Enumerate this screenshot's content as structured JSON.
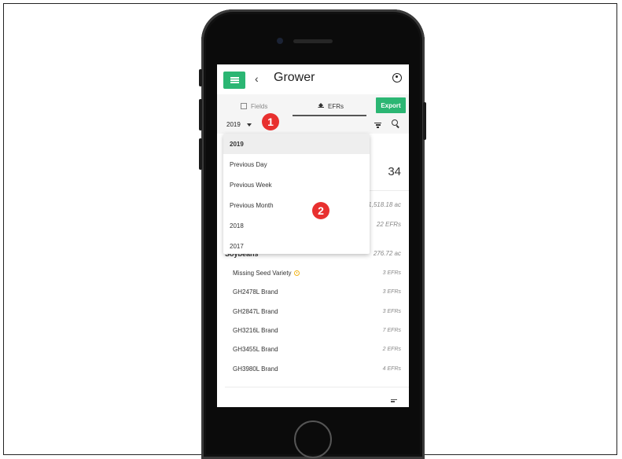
{
  "header": {
    "back_label": "‹",
    "title": "Grower"
  },
  "tabs": [
    {
      "label": "Fields",
      "icon": "fields-icon",
      "active": false
    },
    {
      "label": "EFRs",
      "icon": "layers-icon",
      "active": true
    }
  ],
  "toolbar": {
    "export_label": "Export",
    "year_selected": "2019"
  },
  "dropdown": {
    "options": [
      "2019",
      "Previous Day",
      "Previous Week",
      "Previous Month",
      "2018",
      "2017"
    ],
    "selected": "2019"
  },
  "callouts": {
    "one": "1",
    "two": "2"
  },
  "summary": {
    "total_count": "34",
    "partial_acres": "1,518.18 ac",
    "partial_efrs": "22 EFRs",
    "soy_label": "Soybeans",
    "soy_acres": "276.72 ac"
  },
  "varieties": [
    {
      "name": "Missing Seed Variety",
      "efrs": "3 EFRs",
      "warning": true
    },
    {
      "name": "GH2478L Brand",
      "efrs": "3 EFRs"
    },
    {
      "name": "GH2847L Brand",
      "efrs": "3 EFRs"
    },
    {
      "name": "GH3216L Brand",
      "efrs": "7 EFRs"
    },
    {
      "name": "GH3455L Brand",
      "efrs": "2 EFRs"
    },
    {
      "name": "GH3980L Brand",
      "efrs": "4 EFRs"
    }
  ],
  "colors": {
    "accent": "#2bb673",
    "callout": "#e8302f",
    "warning": "#f2b418"
  }
}
